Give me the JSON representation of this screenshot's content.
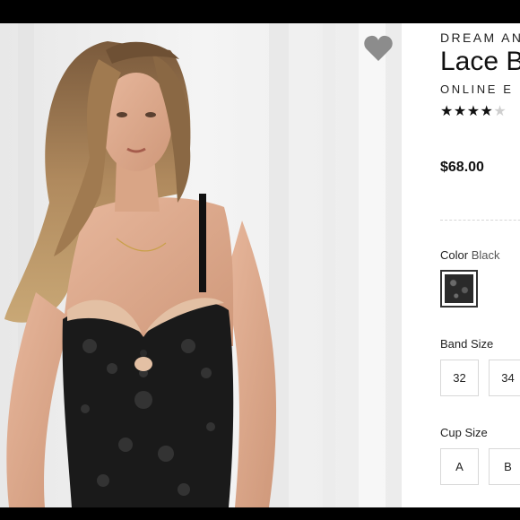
{
  "product": {
    "brand": "DREAM AN",
    "name": "Lace B",
    "exclusive": "ONLINE E",
    "rating": 4,
    "rating_max": 5,
    "price": "$68.00"
  },
  "color": {
    "label": "Color",
    "value": "Black"
  },
  "band_size": {
    "label": "Band Size",
    "options": [
      "32",
      "34"
    ]
  },
  "cup_size": {
    "label": "Cup Size",
    "options": [
      "A",
      "B"
    ]
  },
  "icons": {
    "favorite": "heart-icon"
  },
  "colors": {
    "background": "#ffffff",
    "letterbox": "#000000",
    "heart": "#8c8c8c",
    "text": "#111111",
    "border": "#d8d8d8"
  }
}
